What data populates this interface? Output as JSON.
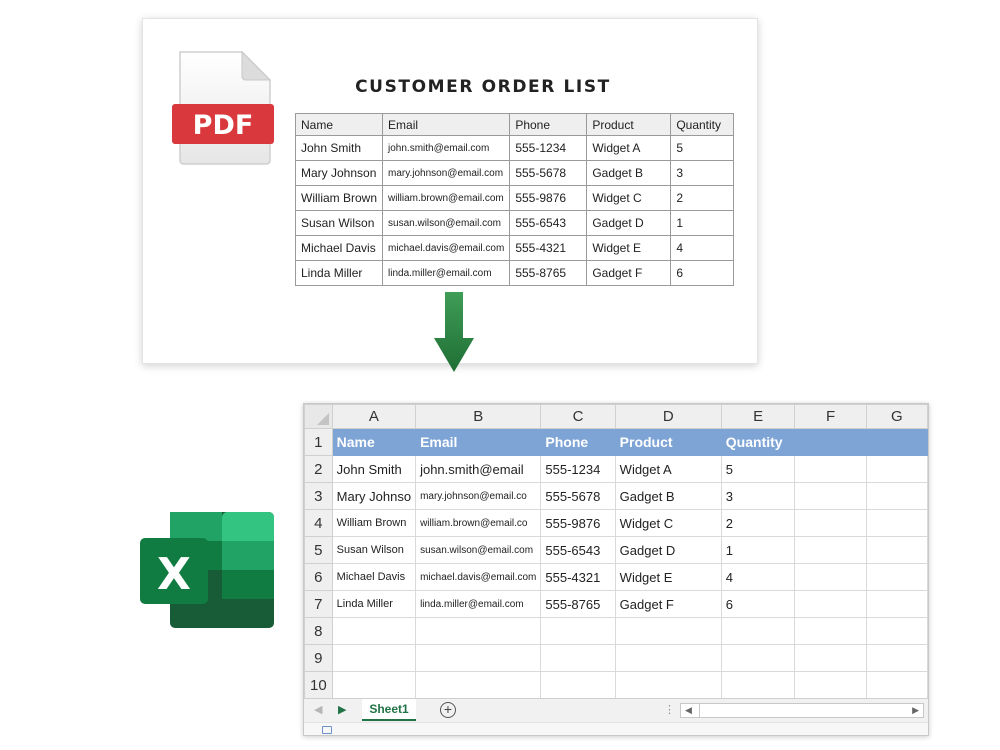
{
  "pdf": {
    "badge": "PDF",
    "title": "CUSTOMER ORDER LIST",
    "headers": [
      "Name",
      "Email",
      "Phone",
      "Product",
      "Quantity"
    ],
    "rows": [
      [
        "John Smith",
        "john.smith@email.com",
        "555-1234",
        "Widget A",
        "5"
      ],
      [
        "Mary Johnson",
        "mary.johnson@email.com",
        "555-5678",
        "Gadget B",
        "3"
      ],
      [
        "William Brown",
        "william.brown@email.com",
        "555-9876",
        "Widget C",
        "2"
      ],
      [
        "Susan Wilson",
        "susan.wilson@email.com",
        "555-6543",
        "Gadget D",
        "1"
      ],
      [
        "Michael Davis",
        "michael.davis@email.com",
        "555-4321",
        "Widget E",
        "4"
      ],
      [
        "Linda Miller",
        "linda.miller@email.com",
        "555-8765",
        "Gadget F",
        "6"
      ]
    ]
  },
  "excel": {
    "icon_letter": "X",
    "columns": [
      "A",
      "B",
      "C",
      "D",
      "E",
      "F",
      "G"
    ],
    "row_numbers": [
      "1",
      "2",
      "3",
      "4",
      "5",
      "6",
      "7",
      "8",
      "9",
      "10"
    ],
    "header_row": [
      "Name",
      "Email",
      "Phone",
      "Product",
      "Quantity"
    ],
    "data_rows": [
      [
        "John Smith",
        "john.smith@email",
        "555-1234",
        "Widget A",
        "5"
      ],
      [
        "Mary Johnso",
        "mary.johnson@email.co",
        "555-5678",
        "Gadget B",
        "3"
      ],
      [
        "William Brown",
        "william.brown@email.co",
        "555-9876",
        "Widget C",
        "2"
      ],
      [
        "Susan Wilson",
        "susan.wilson@email.com",
        "555-6543",
        "Gadget D",
        "1"
      ],
      [
        "Michael Davis",
        "michael.davis@email.com",
        "555-4321",
        "Widget E",
        "4"
      ],
      [
        "Linda Miller",
        "linda.miller@email.com",
        "555-8765",
        "Gadget F",
        "6"
      ]
    ],
    "sheet_tab": "Sheet1",
    "add_sheet": "+",
    "nav_prev": "◀",
    "nav_next": "▶",
    "tab_separator": "⋮",
    "scroll_left": "◀",
    "scroll_right": "▶"
  },
  "colors": {
    "pdf_red": "#d9393c",
    "arrow_green": "#2f8a45",
    "excel_green": "#217346",
    "header_blue": "#7ea4d6"
  },
  "icons": [
    "pdf-file-icon",
    "down-arrow-icon",
    "excel-icon",
    "add-sheet-icon",
    "select-all-icon"
  ]
}
